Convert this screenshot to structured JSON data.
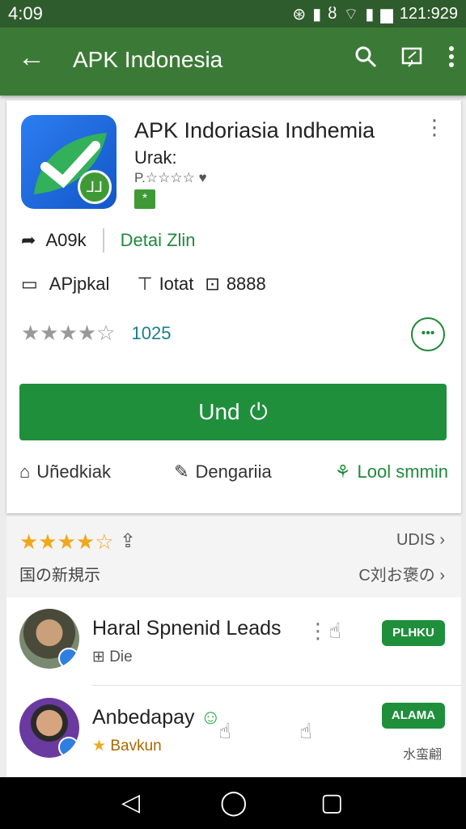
{
  "status_bar": {
    "time": "4:09",
    "battery_text": "121:929"
  },
  "app_bar": {
    "title": "APK Indonesia"
  },
  "app": {
    "title": "APK Indoriasia Indhemia",
    "subtitle": "Urak:",
    "meta": "P.☆☆☆☆ ♥",
    "badge": "*"
  },
  "info": {
    "left_label": "A09k",
    "right_label": "Detai Zlin",
    "type_label": "APjpkal",
    "total_label": "Iotat",
    "size_value": "8888"
  },
  "rating": {
    "value": "1025",
    "stars": "★★★★☆"
  },
  "install_button": {
    "label": "Und"
  },
  "actions": {
    "item1": "Uñedkiak",
    "item2": "Dengariia",
    "item3": "Lool smmin"
  },
  "reviews": {
    "stars": "★★★★☆",
    "more": "UDIS",
    "subtitle": "国の新規示",
    "more2": "C刘お褒の"
  },
  "list": [
    {
      "name": "Haral Spnenid Leads",
      "sub": "Die",
      "pill": "PLHKU"
    },
    {
      "name": "Anbedapay",
      "sub": "Bavkun",
      "pill": "ALAMA",
      "side_text": "水蛮翩"
    }
  ],
  "colors": {
    "primary": "#3b7a36",
    "status": "#2e5c2c",
    "accent": "#1f8f3c",
    "star": "#f0a81c"
  }
}
